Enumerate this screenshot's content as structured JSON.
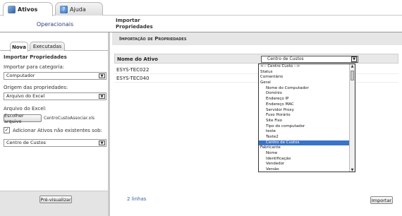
{
  "top_tabs": [
    {
      "label": "Ativos",
      "icon": "assets-icon"
    },
    {
      "label": "Ajuda",
      "icon": "help-icon"
    }
  ],
  "nav": {
    "operacionais": "Operacionais",
    "importar_line1": "Importar",
    "importar_line2": "Propriedades"
  },
  "left": {
    "subtabs": [
      "Nova",
      "Executadas"
    ],
    "section_title": "Importar Propriedades",
    "categoria_label": "Importar para categoria:",
    "categoria_value": "Computador",
    "origem_label": "Origem das propriedades:",
    "origem_value": "Arquivo do Excel",
    "arquivo_label": "Arquivo do Excel:",
    "choose_button": "Escolher arquivo",
    "file_name": "CentroCustoAssociar.xls",
    "adicionar_label": "Adicionar Ativos não existentes sob:",
    "adicionar_checked": "✓",
    "adicionar_value": "Centro de Custos",
    "preview_button": "Pré-visualizar"
  },
  "main": {
    "header": "Importação de Propriedades",
    "column_name": "Nome do Ativo",
    "column_select": "Centro de Custos",
    "rows": [
      "ESYS-TEC022",
      "ESYS-TEC040"
    ],
    "lines_count": "2 linhas",
    "import_button": "Importar"
  },
  "dropdown": {
    "options": [
      {
        "label": "<-- Centro Custo -->",
        "indent": false,
        "selected": false
      },
      {
        "label": "Status",
        "indent": false,
        "selected": false
      },
      {
        "label": "Comentário",
        "indent": false,
        "selected": false
      },
      {
        "label": "Geral",
        "indent": false,
        "selected": false
      },
      {
        "label": "Nome do Computador",
        "indent": true,
        "selected": false
      },
      {
        "label": "Domínio",
        "indent": true,
        "selected": false
      },
      {
        "label": "Endereço IP",
        "indent": true,
        "selected": false
      },
      {
        "label": "Endereço MAC",
        "indent": true,
        "selected": false
      },
      {
        "label": "Servidor Proxy",
        "indent": true,
        "selected": false
      },
      {
        "label": "Fuso Horário",
        "indent": true,
        "selected": false
      },
      {
        "label": "Site Fixo",
        "indent": true,
        "selected": false
      },
      {
        "label": "Tipo do computador",
        "indent": true,
        "selected": false
      },
      {
        "label": "teste",
        "indent": true,
        "selected": false
      },
      {
        "label": "Teste2",
        "indent": true,
        "selected": false
      },
      {
        "label": "Centro de Custos",
        "indent": true,
        "selected": true
      },
      {
        "label": "Fabricante",
        "indent": false,
        "selected": false
      },
      {
        "label": "Nome",
        "indent": true,
        "selected": false
      },
      {
        "label": "Identificação",
        "indent": true,
        "selected": false
      },
      {
        "label": "Vendedor",
        "indent": true,
        "selected": false
      },
      {
        "label": "Versão",
        "indent": true,
        "selected": false
      }
    ]
  },
  "colors": {
    "highlight": "#3a73c8",
    "link_blue": "#3a5fa0",
    "nav_text": "#2f3e7a"
  }
}
